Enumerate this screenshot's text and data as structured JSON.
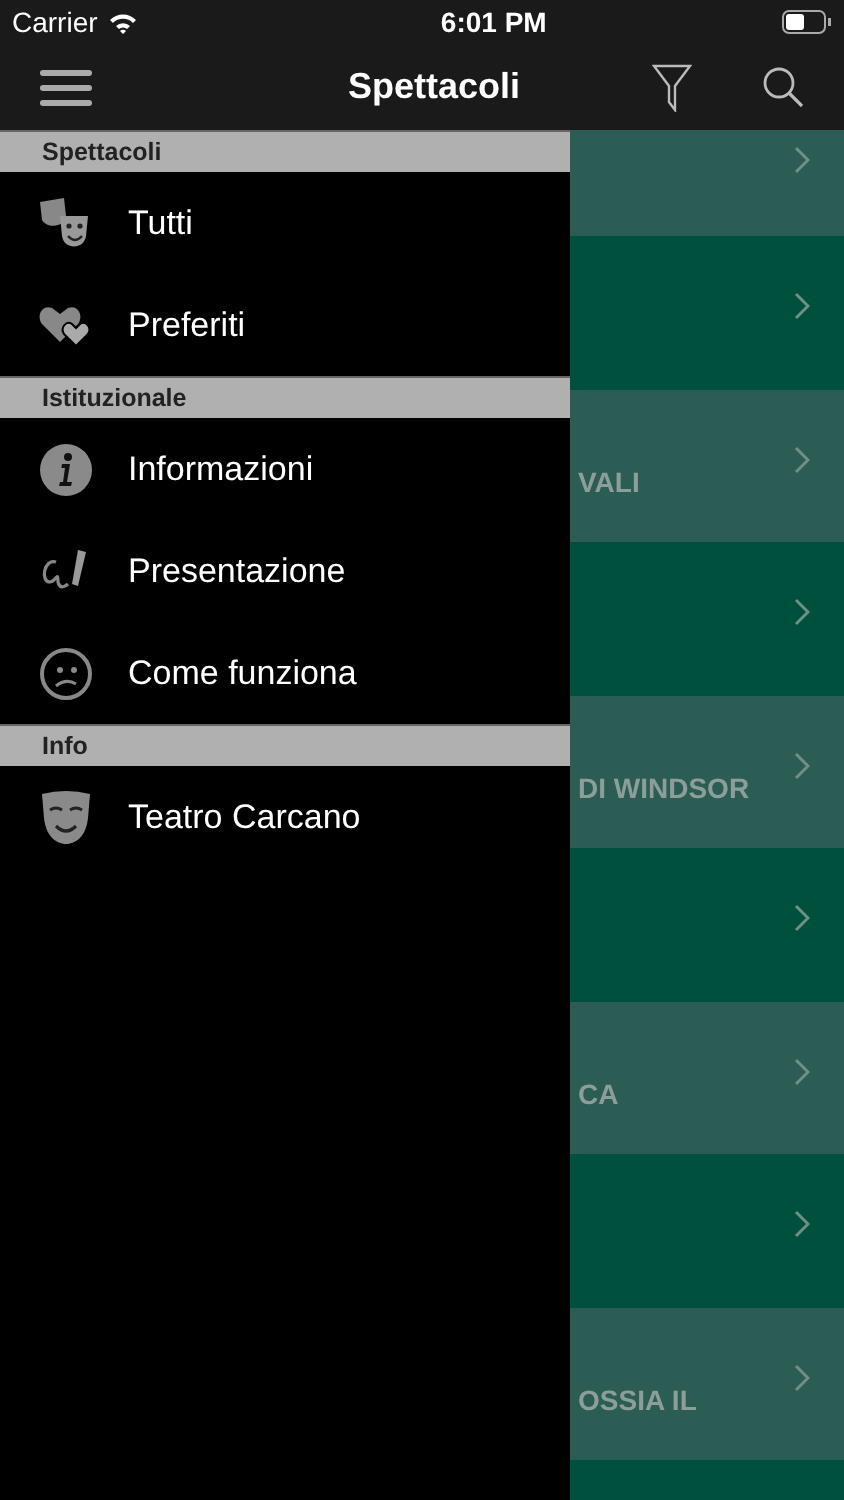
{
  "status_bar": {
    "carrier": "Carrier",
    "time": "6:01 PM"
  },
  "nav_bar": {
    "title": "Spettacoli"
  },
  "drawer": {
    "sections": [
      {
        "title": "Spettacoli",
        "items": [
          {
            "label": "Tutti",
            "kind": "masks"
          },
          {
            "label": "Preferiti",
            "kind": "hearts"
          }
        ]
      },
      {
        "title": "Istituzionale",
        "items": [
          {
            "label": "Informazioni",
            "kind": "info"
          },
          {
            "label": "Presentazione",
            "kind": "pen"
          },
          {
            "label": "Come funziona",
            "kind": "confused"
          }
        ]
      },
      {
        "title": "Info",
        "items": [
          {
            "label": "Teatro Carcano",
            "kind": "mask"
          }
        ]
      }
    ]
  },
  "list": {
    "rows": [
      {
        "kind": "light"
      },
      {
        "kind": "dark"
      },
      {
        "kind": "light",
        "text": "VALI"
      },
      {
        "kind": "dark"
      },
      {
        "kind": "light",
        "text": "DI WINDSOR"
      },
      {
        "kind": "dark"
      },
      {
        "kind": "light",
        "text": "CA"
      },
      {
        "kind": "dark"
      },
      {
        "kind": "light",
        "text": "OSSIA IL"
      },
      {
        "kind": "dark"
      }
    ]
  }
}
